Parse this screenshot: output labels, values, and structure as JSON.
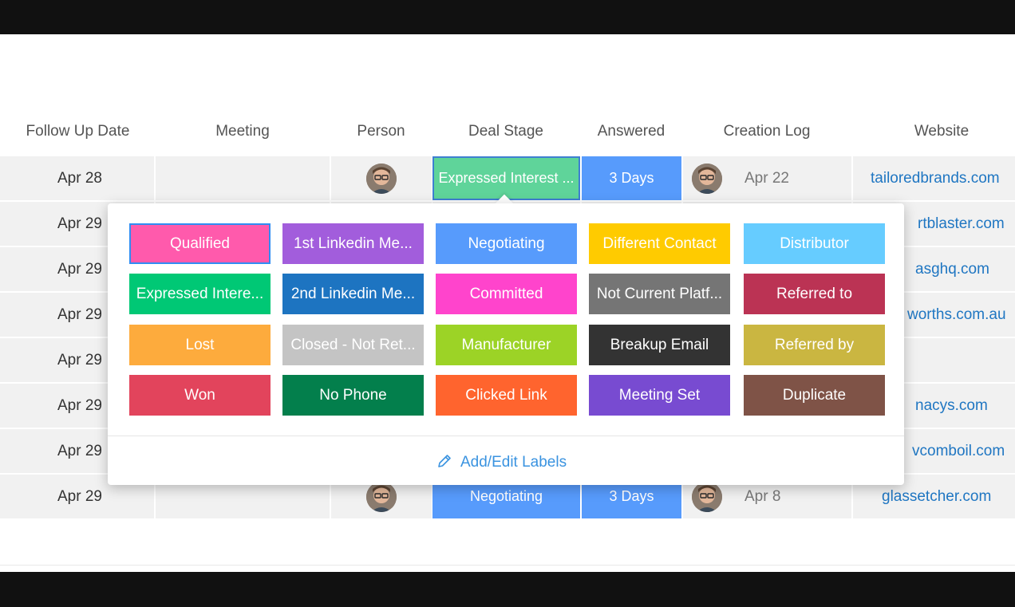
{
  "columns": [
    "Follow Up Date",
    "Meeting",
    "Person",
    "Deal Stage",
    "Answered",
    "Creation Log",
    "Website"
  ],
  "rows": [
    {
      "date": "Apr 28",
      "stage": "Expressed Interest ...",
      "stage_color": "#5fd49a",
      "answered": "3 Days",
      "created": "Apr 22",
      "website": "tailoredbrands.com"
    },
    {
      "date": "Apr 29",
      "website": "rtblaster.com"
    },
    {
      "date": "Apr 29",
      "website": "asghq.com"
    },
    {
      "date": "Apr 29",
      "website": "worths.com.au"
    },
    {
      "date": "Apr 29",
      "website": ""
    },
    {
      "date": "Apr 29",
      "website": "nacys.com"
    },
    {
      "date": "Apr 29",
      "website": "vcomboil.com"
    },
    {
      "date": "Apr 29",
      "stage": "Negotiating",
      "stage_color": "#579bfc",
      "answered": "3 Days",
      "created": "Apr 8",
      "website": "glassetcher.com"
    }
  ],
  "label_picker": {
    "labels": [
      {
        "text": "Qualified",
        "color": "#ff5aac",
        "selected": true
      },
      {
        "text": "1st Linkedin Me...",
        "color": "#a25ddc"
      },
      {
        "text": "Negotiating",
        "color": "#579bfc"
      },
      {
        "text": "Different Contact",
        "color": "#ffcb00"
      },
      {
        "text": "Distributor",
        "color": "#66ccff"
      },
      {
        "text": "Expressed Intere...",
        "color": "#00c875"
      },
      {
        "text": "2nd Linkedin Me...",
        "color": "#1d74c1"
      },
      {
        "text": "Committed",
        "color": "#ff44cc"
      },
      {
        "text": "Not Current Platf...",
        "color": "#757575"
      },
      {
        "text": "Referred to",
        "color": "#bb3354"
      },
      {
        "text": "Lost",
        "color": "#fdab3d"
      },
      {
        "text": "Closed - Not Ret...",
        "color": "#c4c4c4"
      },
      {
        "text": "Manufacturer",
        "color": "#9cd326"
      },
      {
        "text": "Breakup Email",
        "color": "#333333"
      },
      {
        "text": "Referred by",
        "color": "#cab641"
      },
      {
        "text": "Won",
        "color": "#e2445c"
      },
      {
        "text": "No Phone",
        "color": "#037f4c"
      },
      {
        "text": "Clicked Link",
        "color": "#ff642e"
      },
      {
        "text": "Meeting Set",
        "color": "#784bd1"
      },
      {
        "text": "Duplicate",
        "color": "#7f5347"
      }
    ],
    "add_edit_label": "Add/Edit Labels"
  },
  "icons": {
    "avatar": "person-avatar-icon",
    "edit": "pencil-icon"
  }
}
